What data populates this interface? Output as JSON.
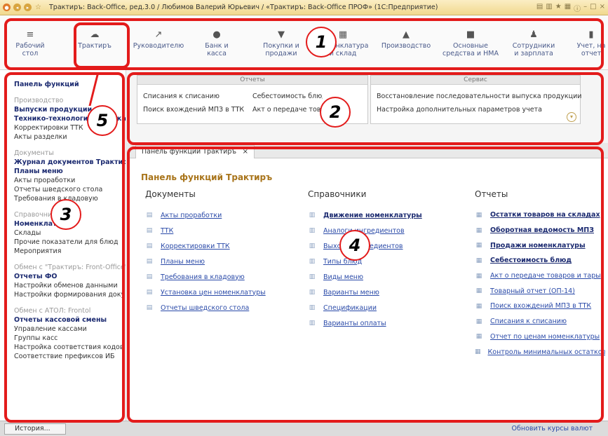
{
  "titlebar": {
    "title": "Трактиръ: Back-Office, ред.3.0 / Любимов Валерий Юрьевич / «Трактиръ: Back-Office ПРОФ» (1С:Предприятие)"
  },
  "sections": [
    {
      "label": "Рабочий\nстол",
      "icon": "menu-icon"
    },
    {
      "label": "Трактиръ",
      "icon": "trakt-icon"
    },
    {
      "label": "Руководителю",
      "icon": "chart-icon"
    },
    {
      "label": "Банк и\nкасса",
      "icon": "coin-icon"
    },
    {
      "label": "Покупки и\nпродажи",
      "icon": "cart-icon"
    },
    {
      "label": "Номенклатура\nи склад",
      "icon": "grid-icon"
    },
    {
      "label": "Производство",
      "icon": "factory-icon"
    },
    {
      "label": "Основные\nсредства и НМА",
      "icon": "truck-icon"
    },
    {
      "label": "Сотрудники\nи зарплата",
      "icon": "person-icon"
    },
    {
      "label": "Учет, на\nотчет",
      "icon": "bars-icon"
    }
  ],
  "left_panel": {
    "title": "Панель функций",
    "groups": [
      {
        "name": "Производство",
        "items": [
          {
            "label": "Выпуски продукции",
            "bold": true
          },
          {
            "label": "Технико-технологические карты",
            "bold": true
          },
          {
            "label": "Корректировки ТТК",
            "bold": false
          },
          {
            "label": "Акты разделки",
            "bold": false
          }
        ]
      },
      {
        "name": "Документы",
        "items": [
          {
            "label": "Журнал документов Трактиръ",
            "bold": true
          },
          {
            "label": "Планы меню",
            "bold": true
          },
          {
            "label": "Акты проработки",
            "bold": false
          },
          {
            "label": "Отчеты шведского стола",
            "bold": false
          },
          {
            "label": "Требования в кладовую",
            "bold": false
          }
        ]
      },
      {
        "name": "Справочники",
        "items": [
          {
            "label": "Номенклатура",
            "bold": true
          },
          {
            "label": "Склады",
            "bold": false
          },
          {
            "label": "Прочие показатели для блюд",
            "bold": false
          },
          {
            "label": "Мероприятия",
            "bold": false
          }
        ]
      },
      {
        "name": "Обмен с \"Трактиръ: Front-Office\"",
        "items": [
          {
            "label": "Отчеты ФО",
            "bold": true
          },
          {
            "label": "Настройки обменов данными",
            "bold": false
          },
          {
            "label": "Настройки формирования документов",
            "bold": false
          }
        ]
      },
      {
        "name": "Обмен с АТОЛ: Frontol",
        "items": [
          {
            "label": "Отчеты кассовой смены",
            "bold": true
          },
          {
            "label": "Управление кассами",
            "bold": false
          },
          {
            "label": "Группы касс",
            "bold": false
          },
          {
            "label": "Настройка соответствия кодов",
            "bold": false
          },
          {
            "label": "Соответствие префиксов ИБ",
            "bold": false
          }
        ]
      }
    ]
  },
  "top_panel": {
    "reports_title": "Отчеты",
    "reports_links": [
      "Списания к списанию",
      "Поиск вхождений МПЗ в ТТК",
      "Себестоимость блюд",
      "Акт о передаче товаров и тары"
    ],
    "service_title": "Сервис",
    "service_links": [
      "Восстановление последовательности выпуска продукции",
      "Настройка дополнительных параметров учета"
    ]
  },
  "tab": {
    "label": "Панель функций Трактиръ",
    "close": "×"
  },
  "main": {
    "title": "Панель функций Трактиръ",
    "documents_title": "Документы",
    "documents": [
      "Акты проработки",
      "ТТК",
      "Корректировки ТТК",
      "Планы меню",
      "Требования в кладовую",
      "Установка цен номенклатуры",
      "Отчеты шведского стола"
    ],
    "directories_title": "Справочники",
    "directories": [
      {
        "label": "Движение номенклатуры",
        "bold": true
      },
      {
        "label": "Аналоги ингредиентов",
        "bold": false
      },
      {
        "label": "Выходы ингредиентов",
        "bold": false
      },
      {
        "label": "Типы блюд",
        "bold": false
      },
      {
        "label": "Виды меню",
        "bold": false
      },
      {
        "label": "Варианты меню",
        "bold": false
      },
      {
        "label": "Спецификации",
        "bold": false
      },
      {
        "label": "Варианты оплаты",
        "bold": false
      }
    ],
    "reports_title": "Отчеты",
    "reports": [
      {
        "label": "Остатки товаров на складах",
        "bold": true
      },
      {
        "label": "Оборотная ведомость МПЗ",
        "bold": true
      },
      {
        "label": "Продажи номенклатуры",
        "bold": true
      },
      {
        "label": "Себестоимость блюд",
        "bold": true
      },
      {
        "label": "Акт о передаче товаров и тары",
        "bold": false
      },
      {
        "label": "Товарный отчет (ОП-14)",
        "bold": false
      },
      {
        "label": "Поиск вхождений МПЗ в ТТК",
        "bold": false
      },
      {
        "label": "Списания к списанию",
        "bold": false
      },
      {
        "label": "Отчет по ценам номенклатуры",
        "bold": false
      },
      {
        "label": "Контроль минимальных остатков",
        "bold": false
      }
    ]
  },
  "statusbar": {
    "history": "История...",
    "update_rates": "Обновить курсы валют"
  },
  "annotations": [
    "1",
    "2",
    "3",
    "4",
    "5"
  ],
  "colors": {
    "annotation": "#e31b1b",
    "link": "#2a4aa8",
    "title_gold": "#a8741a"
  }
}
